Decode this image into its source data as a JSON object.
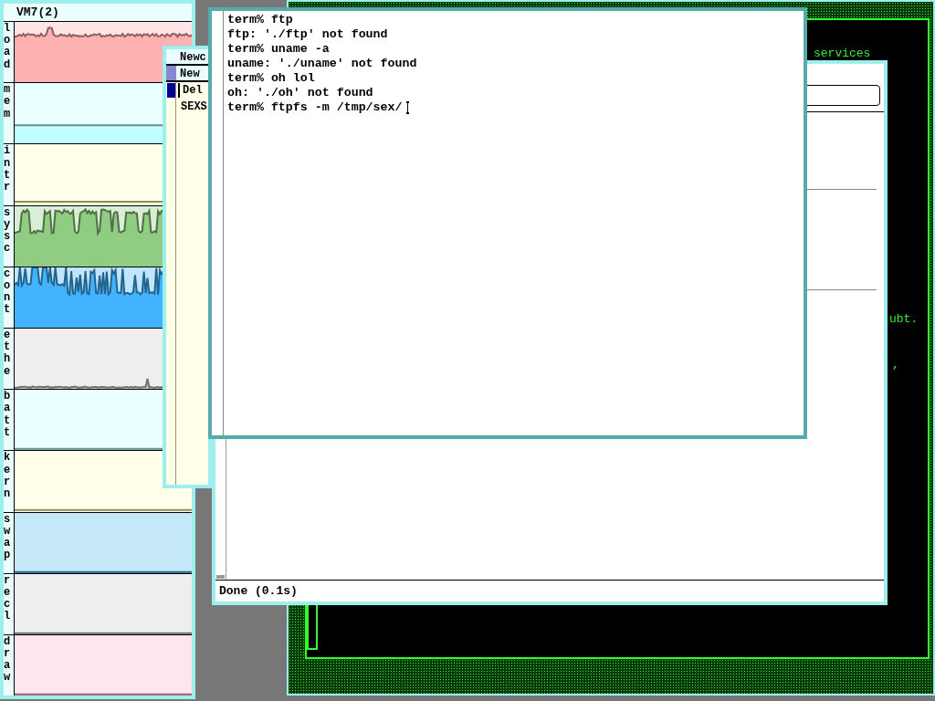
{
  "stats_window": {
    "title": "VM7(2)",
    "graphs": [
      {
        "label": "load",
        "color": "#ffe5e5"
      },
      {
        "label": "mem",
        "color": "#eaffff"
      },
      {
        "label": "intr",
        "color": "#ffffea"
      },
      {
        "label": "sysc",
        "color": "#daeed5"
      },
      {
        "label": "cont",
        "color": "#c0e6ff"
      },
      {
        "label": "ethe",
        "color": "#eeeeee"
      },
      {
        "label": "batt",
        "color": "#eaffff"
      },
      {
        "label": "kern",
        "color": "#ffffea"
      },
      {
        "label": "swap",
        "color": "#c4e8f8"
      },
      {
        "label": "recl",
        "color": "#eeeeee"
      },
      {
        "label": "draw",
        "color": "#ffe6ee"
      }
    ]
  },
  "mail_window": {
    "title": "Newc",
    "tag": "New",
    "items": [
      {
        "label": "Del",
        "selected": true
      },
      {
        "label": "SEXS",
        "selected": false
      }
    ]
  },
  "green_window": {
    "texts": [
      "services",
      "ubt.",
      ","
    ]
  },
  "browser_window": {
    "status": "Done (0.1s)"
  },
  "terminal_window": {
    "lines": [
      "term% ftp",
      "ftp: './ftp' not found",
      "term% uname -a",
      "uname: './uname' not found",
      "term% oh lol",
      "oh: './oh' not found",
      "term% ftpfs -m /tmp/sex/"
    ],
    "cursor": true
  }
}
